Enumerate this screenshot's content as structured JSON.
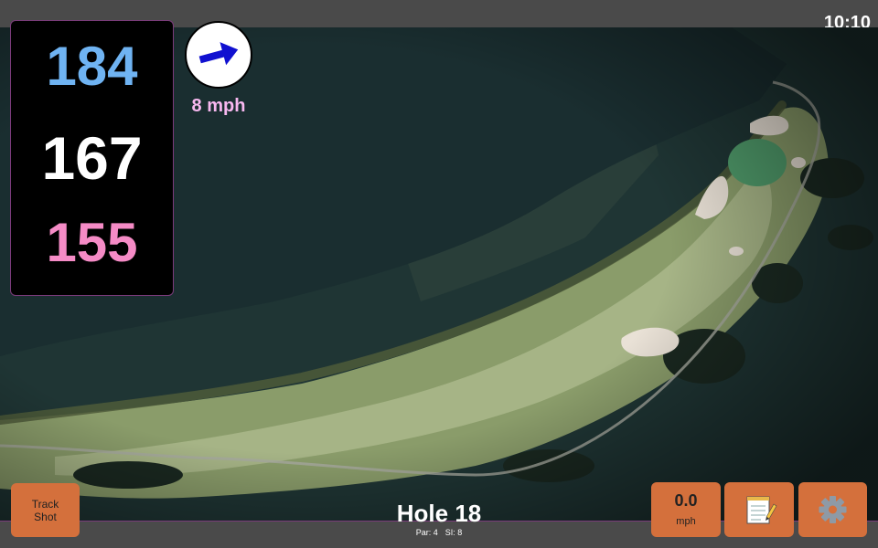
{
  "status_bar": {
    "time": "10:10"
  },
  "distances": {
    "back": "184",
    "middle": "167",
    "front": "155"
  },
  "wind": {
    "speed_label": "8 mph",
    "direction_icon": "arrow-icon"
  },
  "hole": {
    "title": "Hole 18",
    "par_label": "Par: 4",
    "si_label": "SI: 8"
  },
  "buttons": {
    "track_shot_line1": "Track",
    "track_shot_line2": "Shot",
    "wind_value": "0.0",
    "wind_unit": "mph",
    "notes_icon": "notepad-icon",
    "settings_icon": "gear-icon"
  },
  "colors": {
    "back_distance": "#6fb3f2",
    "middle_distance": "#ffffff",
    "front_distance": "#f58bc6",
    "wind_speed_text": "#f8b8f0",
    "wind_arrow": "#1010d0",
    "button_bg": "#d4703c",
    "panel_border": "#7b3b7b"
  }
}
